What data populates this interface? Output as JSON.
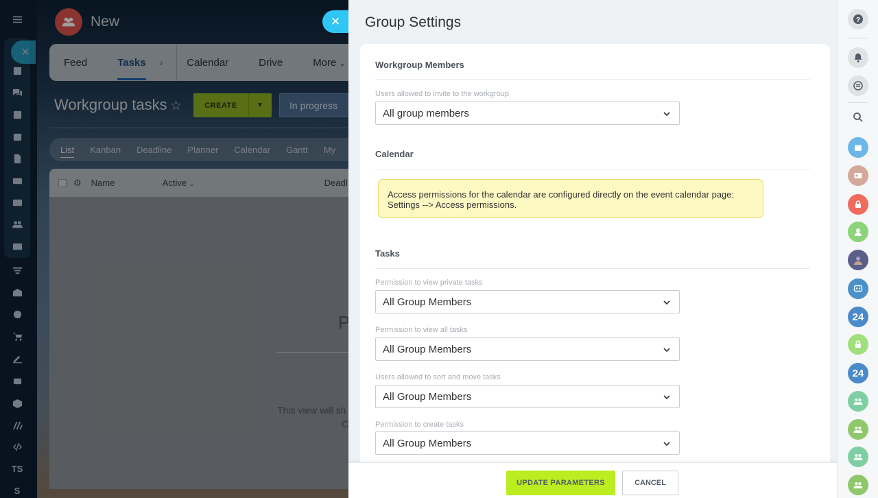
{
  "background": {
    "group_name": "New",
    "top_nav": [
      "Feed",
      "Tasks",
      "Calendar",
      "Drive",
      "More"
    ],
    "active_nav": "Tasks",
    "page_title": "Workgroup tasks",
    "create_label": "CREATE",
    "filter_label": "In progress",
    "view_tabs": [
      "List",
      "Kanban",
      "Deadline",
      "Planner",
      "Calendar",
      "Gantt",
      "My"
    ],
    "grid_columns": [
      "Name",
      "Active",
      "Deadl"
    ],
    "empty_big": "P",
    "empty_text": "This view will sh",
    "empty_text2": "C",
    "rail_labels": [
      "TS",
      "S"
    ]
  },
  "panel": {
    "title": "Group Settings",
    "sections": {
      "workgroup": {
        "title": "Workgroup Members",
        "invite_label": "Users allowed to invite to the workgroup",
        "invite_value": "All group members"
      },
      "calendar": {
        "title": "Calendar",
        "note_line1": "Access permissions for the calendar are configured directly on the event calendar page:",
        "note_line2": "Settings --> Access permissions."
      },
      "tasks": {
        "title": "Tasks",
        "fields": [
          {
            "label": "Permission to view private tasks",
            "value": "All Group Members"
          },
          {
            "label": "Permission to view all tasks",
            "value": "All Group Members"
          },
          {
            "label": "Users allowed to sort and move tasks",
            "value": "All Group Members"
          },
          {
            "label": "Permission to create tasks",
            "value": "All Group Members"
          }
        ]
      }
    },
    "footer": {
      "update_label": "UPDATE PARAMETERS",
      "cancel_label": "CANCEL"
    }
  },
  "right_rail": {
    "badge_24": "24"
  },
  "colors": {
    "accent_green": "#bbed21",
    "slider_close": "#2fc6f6",
    "note_bg": "#fdf9c3"
  }
}
